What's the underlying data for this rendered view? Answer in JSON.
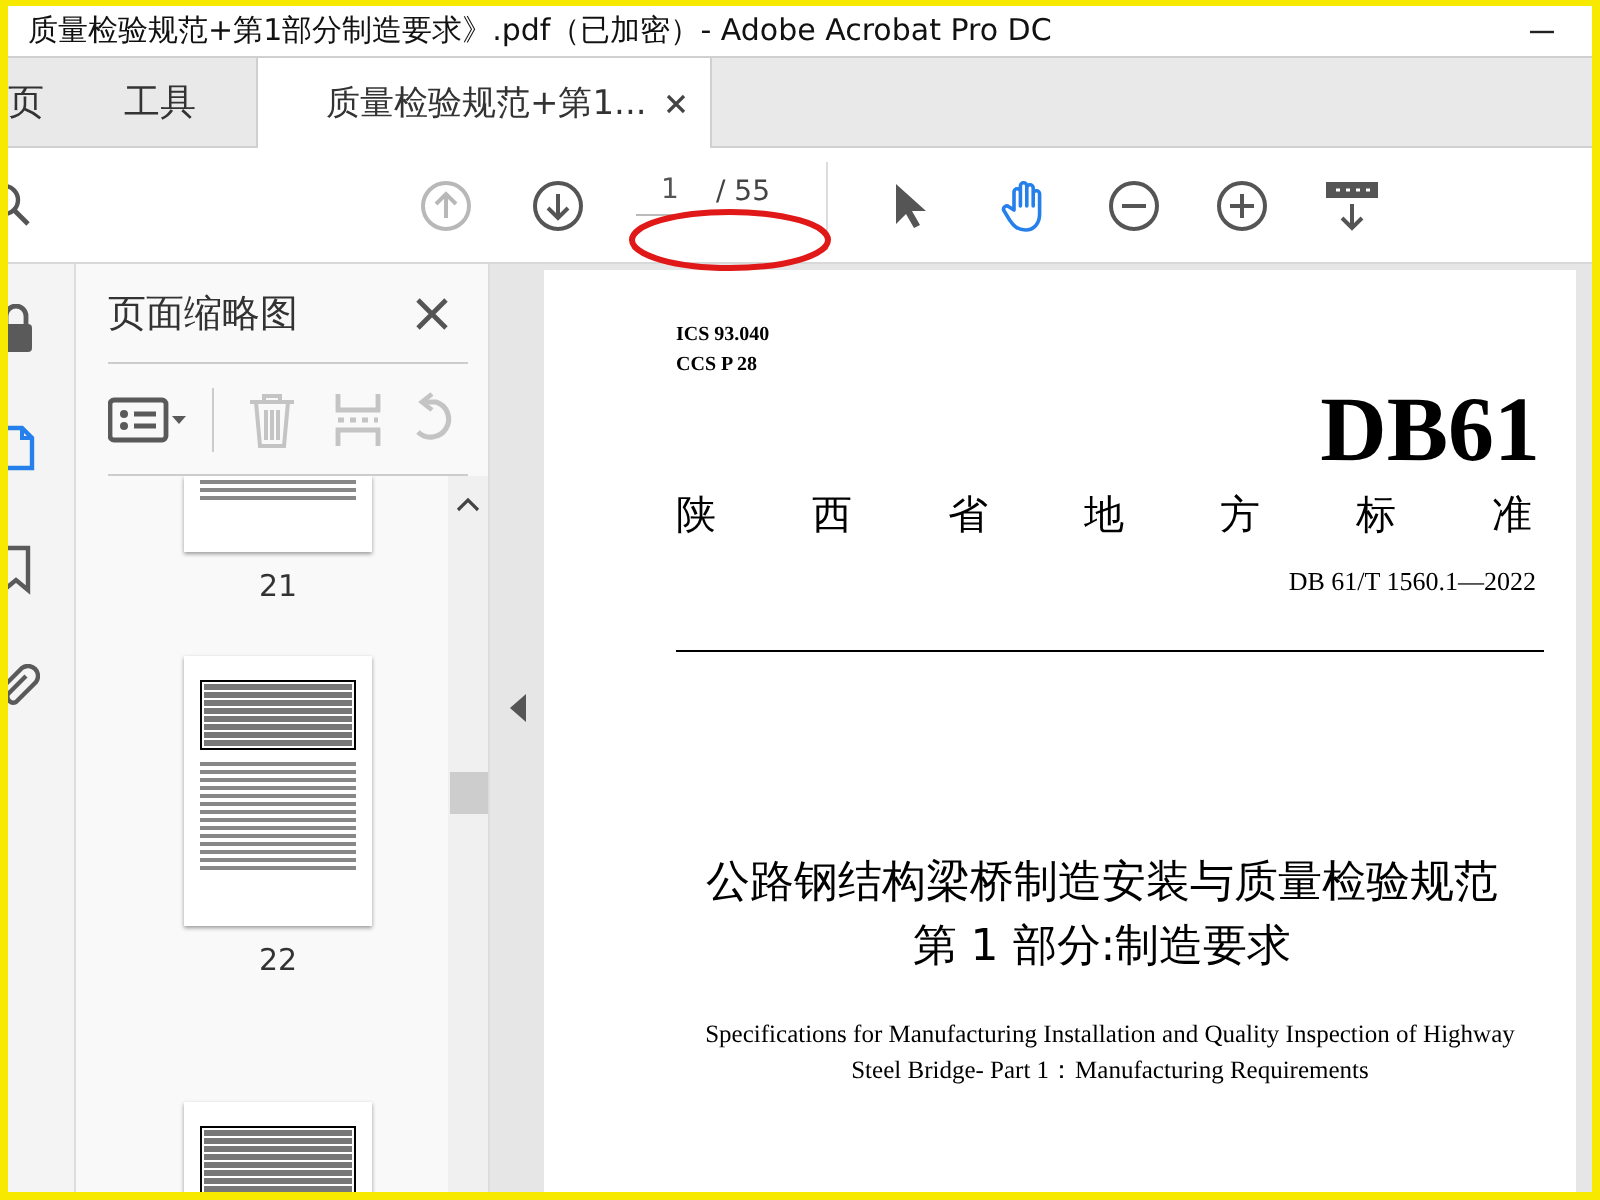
{
  "window": {
    "title": "质量检验规范+第1部分制造要求》.pdf（已加密）- Adobe Acrobat Pro DC"
  },
  "tabs": [
    {
      "label": "页",
      "selected": false,
      "closable": false
    },
    {
      "label": "工具",
      "selected": false,
      "closable": false
    },
    {
      "label": "质量检验规范+第1...",
      "selected": true,
      "closable": true
    }
  ],
  "toolbar": {
    "nav": [
      {
        "kind": "search",
        "disabled": false
      },
      {
        "kind": "prev-page",
        "disabled": true
      },
      {
        "kind": "next-page",
        "disabled": false
      }
    ],
    "page_field": {
      "value": "1",
      "total": "/ 55"
    },
    "tools": [
      {
        "kind": "select",
        "selected": false
      },
      {
        "kind": "hand",
        "selected": true
      },
      {
        "kind": "zoom-out",
        "selected": false
      },
      {
        "kind": "zoom-in",
        "selected": false
      },
      {
        "kind": "read-mode",
        "selected": false
      }
    ]
  },
  "annotations": [
    {
      "kind": "ellipse"
    }
  ],
  "left_rail": [
    {
      "kind": "lock",
      "selected": false
    },
    {
      "kind": "pages",
      "selected": true
    },
    {
      "kind": "bookmark",
      "selected": false
    },
    {
      "kind": "attachment",
      "selected": false
    }
  ],
  "thumbnail_panel": {
    "title": "页面缩略图",
    "tools": [
      {
        "kind": "options",
        "disabled": false
      },
      {
        "kind": "delete",
        "disabled": true
      },
      {
        "kind": "extract",
        "disabled": true
      },
      {
        "kind": "rotate",
        "disabled": true
      }
    ],
    "thumbnails": [
      {
        "kind": "cut",
        "label": "21"
      },
      {
        "kind": "full",
        "label": "22"
      },
      {
        "kind": "top"
      }
    ]
  },
  "document": {
    "ics": "ICS  93.040",
    "ccs": "CCS P 28",
    "code": "DB61",
    "authority": "陕 西 省 地 方 标 准",
    "number": "DB 61/T  1560.1—2022",
    "title_zh": [
      "公路钢结构梁桥制造安装与质量检验规范",
      "第 1 部分:制造要求"
    ],
    "title_en": "Specifications for Manufacturing Installation and Quality Inspection of Highway Steel Bridge- Part 1：Manufacturing Requirements"
  }
}
